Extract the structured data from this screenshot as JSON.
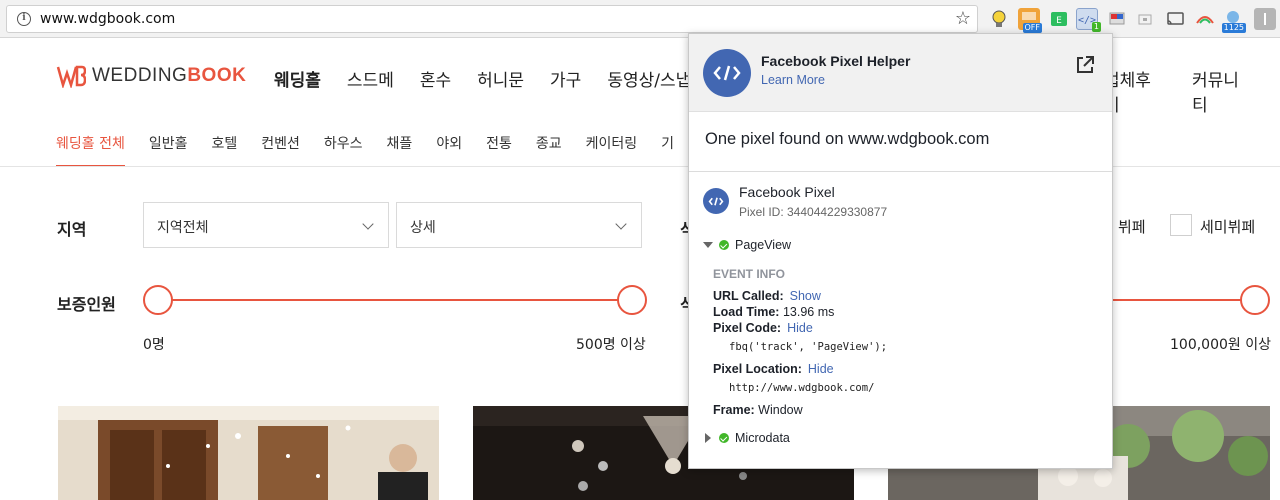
{
  "browser": {
    "url": "www.wdgbook.com",
    "extensions": [
      {
        "name": "bulb",
        "badge": ""
      },
      {
        "name": "off",
        "badge": "OFF"
      },
      {
        "name": "evernote",
        "badge": ""
      },
      {
        "name": "pixel-helper",
        "badge": "1"
      },
      {
        "name": "flag",
        "badge": ""
      },
      {
        "name": "window",
        "badge": ""
      },
      {
        "name": "cast",
        "badge": ""
      },
      {
        "name": "naver",
        "badge": ""
      },
      {
        "name": "weather",
        "badge": "1125"
      },
      {
        "name": "menu",
        "badge": ""
      }
    ]
  },
  "site": {
    "logo_text_1": "WEDDING",
    "logo_text_2": "BOOK",
    "main_nav": [
      "웨딩홀",
      "스드메",
      "혼수",
      "허니문",
      "가구",
      "동영상/스냅"
    ],
    "right_nav": [
      "업체후기",
      "커뮤니티"
    ],
    "sub_nav": [
      "웨딩홀 전체",
      "일반홀",
      "호텔",
      "컨벤션",
      "하우스",
      "채플",
      "야외",
      "전통",
      "종교",
      "케이터링",
      "기"
    ],
    "filters": {
      "region_label": "지역",
      "region_select": "지역전체",
      "detail_select": "상세",
      "guests_label": "보증인원",
      "guests_min": "0명",
      "guests_max": "500명 이상",
      "price_max": "100,000원 이상",
      "partial_label_1": "식",
      "partial_label_2": "식",
      "buffet_label": "뷔페",
      "semi_buffet_label": "세미뷔페"
    }
  },
  "popup": {
    "title": "Facebook Pixel Helper",
    "learn_more": "Learn More",
    "summary": "One pixel found on www.wdgbook.com",
    "pixel_name": "Facebook Pixel",
    "pixel_id": "Pixel ID: 344044229330877",
    "event_name": "PageView",
    "event_info_title": "EVENT INFO",
    "url_called_label": "URL Called:",
    "url_called_link": "Show",
    "load_time_label": "Load Time:",
    "load_time_value": "13.96 ms",
    "pixel_code_label": "Pixel Code:",
    "pixel_code_link": "Hide",
    "pixel_code": "fbq('track', 'PageView');",
    "pixel_location_label": "Pixel Location:",
    "pixel_location_link": "Hide",
    "pixel_location": "http://www.wdgbook.com/",
    "frame_label": "Frame:",
    "frame_value": "Window",
    "microdata": "Microdata"
  },
  "colors": {
    "brand": "#e8553f",
    "facebook": "#4267b2",
    "success": "#42b72a"
  }
}
